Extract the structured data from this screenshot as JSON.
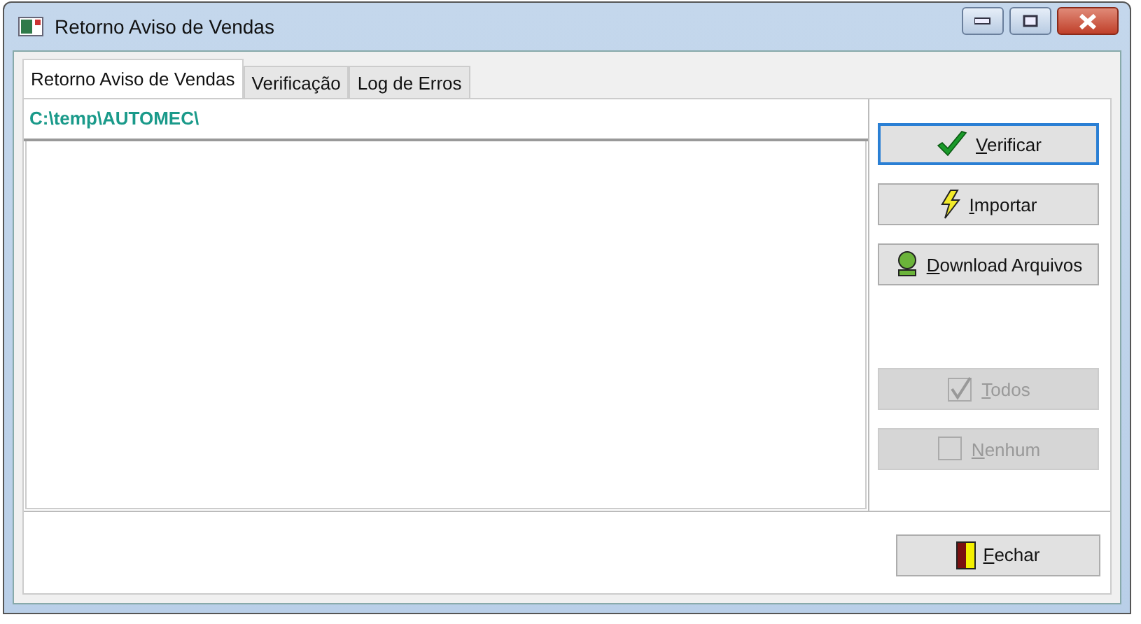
{
  "window": {
    "title": "Retorno Aviso de Vendas"
  },
  "tabs": [
    {
      "label": "Retorno Aviso de Vendas",
      "selected": true
    },
    {
      "label": "Verificação",
      "selected": false
    },
    {
      "label": "Log de Erros",
      "selected": false
    }
  ],
  "path": "C:\\temp\\AUTOMEC\\",
  "actions": [
    {
      "kind": "check",
      "accel": "V",
      "rest": "erificar",
      "disabled": false,
      "focused": true
    },
    {
      "kind": "bolt",
      "accel": "I",
      "rest": "mportar",
      "disabled": false,
      "focused": false
    },
    {
      "kind": "download",
      "accel": "D",
      "rest": "ownload Arquivos",
      "disabled": false,
      "focused": false
    },
    {
      "kind": "all",
      "accel": "T",
      "rest": "odos",
      "disabled": true,
      "focused": false
    },
    {
      "kind": "none",
      "accel": "N",
      "rest": "enhum",
      "disabled": true,
      "focused": false
    }
  ],
  "close_button": {
    "accel": "F",
    "rest": "echar"
  }
}
